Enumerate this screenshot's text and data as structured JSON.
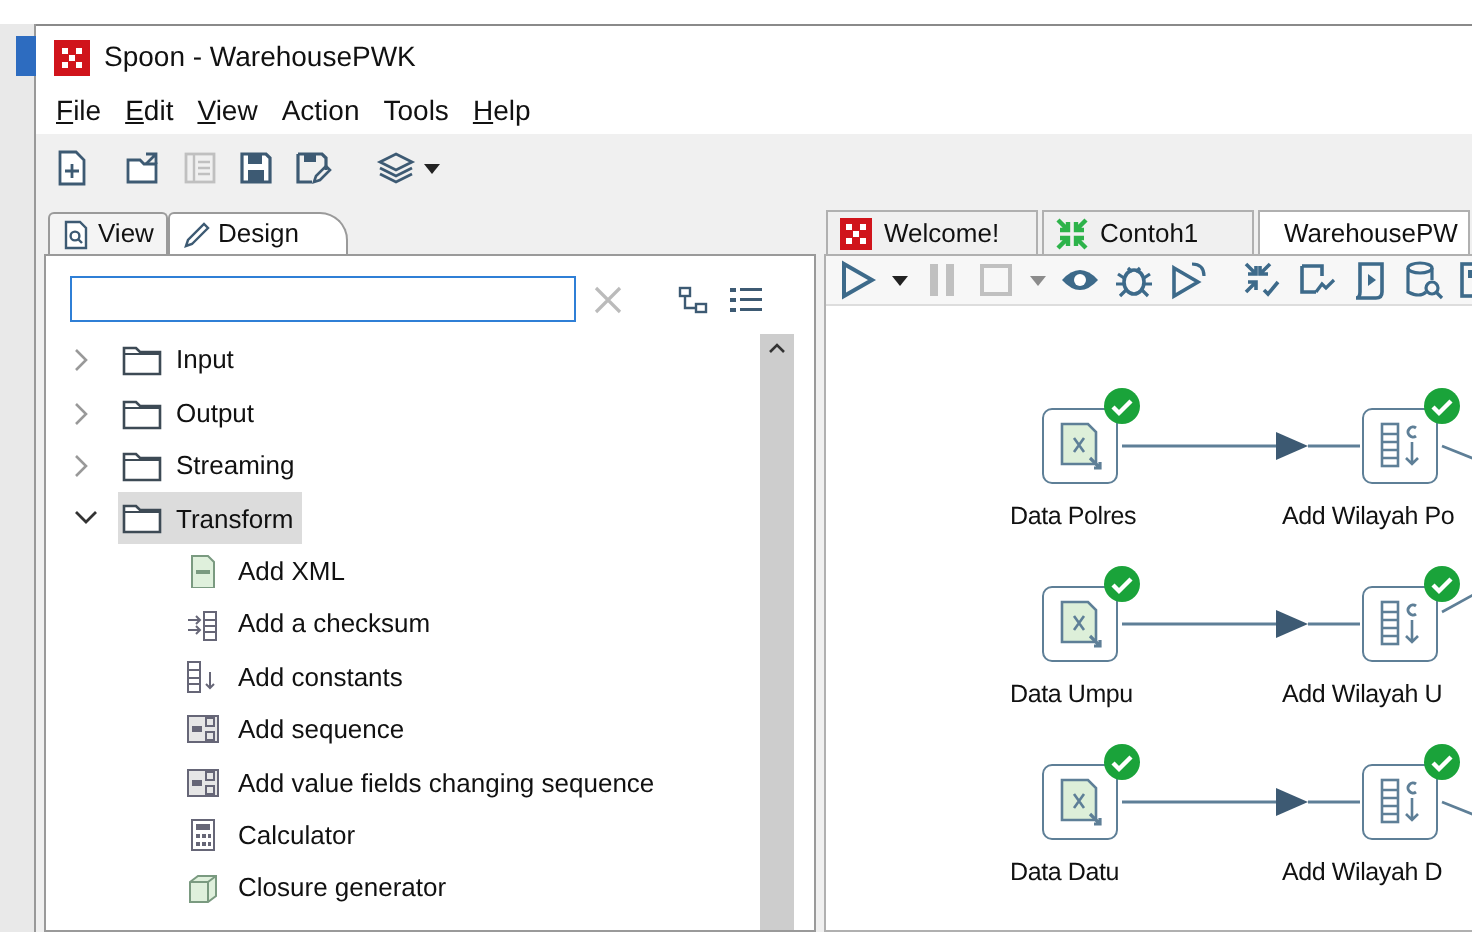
{
  "window": {
    "title": "Spoon - WarehousePWK"
  },
  "menu": [
    {
      "label": "File",
      "mnemonic": true
    },
    {
      "label": "Edit",
      "mnemonic": true
    },
    {
      "label": "View",
      "mnemonic": true
    },
    {
      "label": "Action",
      "mnemonic": false
    },
    {
      "label": "Tools",
      "mnemonic": false
    },
    {
      "label": "Help",
      "mnemonic": true
    }
  ],
  "main_toolbar": [
    {
      "kind": "new",
      "disabled": false
    },
    {
      "kind": "open",
      "disabled": false
    },
    {
      "kind": "explore",
      "disabled": true
    },
    {
      "kind": "save",
      "disabled": false
    },
    {
      "kind": "save-as",
      "disabled": false
    },
    {
      "kind": "layers",
      "disabled": false
    }
  ],
  "left_tabs": [
    {
      "label": "View",
      "kind": "view",
      "selected": false
    },
    {
      "label": "Design",
      "kind": "design",
      "selected": true
    }
  ],
  "tree": [
    {
      "label": "Input",
      "expanded": false,
      "selected": false
    },
    {
      "label": "Output",
      "expanded": false,
      "selected": false
    },
    {
      "label": "Streaming",
      "expanded": false,
      "selected": false
    },
    {
      "label": "Transform",
      "expanded": true,
      "selected": true,
      "children": [
        {
          "label": "Add XML",
          "kind": "xml"
        },
        {
          "label": "Add a checksum",
          "kind": "checksum"
        },
        {
          "label": "Add constants",
          "kind": "constants"
        },
        {
          "label": "Add sequence",
          "kind": "sequence"
        },
        {
          "label": "Add value fields changing sequence",
          "kind": "sequence"
        },
        {
          "label": "Calculator",
          "kind": "calculator"
        },
        {
          "label": "Closure generator",
          "kind": "closure"
        }
      ]
    }
  ],
  "editor_tabs": [
    {
      "label": "Welcome!",
      "kind": "welcome",
      "selected": false
    },
    {
      "label": "Contoh1",
      "kind": "transformation",
      "selected": false
    },
    {
      "label": "WarehousePW",
      "kind": "transformation",
      "selected": true
    }
  ],
  "editor_toolbar": [
    {
      "kind": "run",
      "disabled": false
    },
    {
      "kind": "dropdown",
      "disabled": false
    },
    {
      "kind": "pause",
      "disabled": true
    },
    {
      "kind": "stop",
      "disabled": true
    },
    {
      "kind": "dropdown",
      "disabled": true
    },
    {
      "kind": "preview",
      "disabled": false
    },
    {
      "kind": "debug",
      "disabled": false
    },
    {
      "kind": "replay",
      "disabled": false
    },
    {
      "kind": "verify",
      "disabled": false
    },
    {
      "kind": "impact",
      "disabled": false
    },
    {
      "kind": "sql",
      "disabled": false
    },
    {
      "kind": "explore-db",
      "disabled": false
    },
    {
      "kind": "grid",
      "disabled": false
    }
  ],
  "canvas_rows": [
    {
      "steps": [
        {
          "label": "Data Polres",
          "kind": "excel-input",
          "ok": true
        },
        {
          "label": "Add Wilayah Po",
          "kind": "add-constants",
          "ok": true,
          "outgoing_hop": true,
          "outgoing_up": false
        }
      ]
    },
    {
      "steps": [
        {
          "label": "Data Umpu",
          "kind": "excel-input",
          "ok": true
        },
        {
          "label": "Add Wilayah U",
          "kind": "add-constants",
          "ok": true,
          "outgoing_hop": true,
          "outgoing_up": true
        }
      ]
    },
    {
      "steps": [
        {
          "label": "Data Datu",
          "kind": "excel-input",
          "ok": true
        },
        {
          "label": "Add Wilayah D",
          "kind": "add-constants",
          "ok": true,
          "outgoing_hop": true,
          "outgoing_up": false
        }
      ]
    }
  ]
}
